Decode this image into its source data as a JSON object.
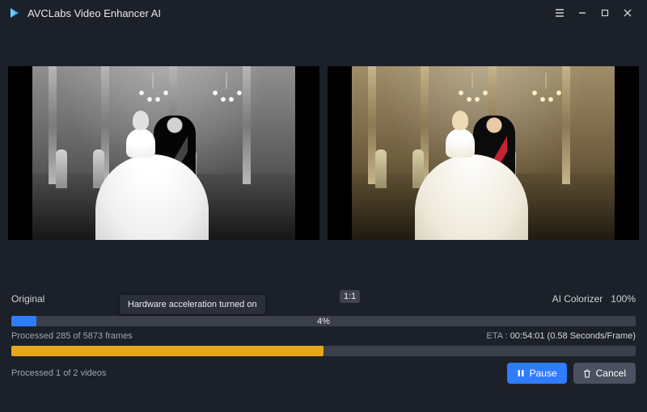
{
  "titlebar": {
    "app_name": "AVCLabs Video Enhancer AI"
  },
  "preview": {
    "left_label": "Original",
    "right_label": "AI Colorizer",
    "zoom_percent": "100%",
    "ratio_badge": "1:1"
  },
  "tooltip": {
    "hw_accel": "Hardware acceleration turned on"
  },
  "progress": {
    "percent_label": "4%",
    "percent_value": 4,
    "frames_text": "Processed 285 of 5873 frames",
    "frame_fill_percent": 50,
    "eta_prefix": "ETA :",
    "eta_value": "00:54:01 (0.58 Seconds/Frame)",
    "videos_text": "Processed 1 of 2 videos"
  },
  "buttons": {
    "pause": "Pause",
    "cancel": "Cancel"
  },
  "colors": {
    "accent_blue": "#2f7cff",
    "accent_orange": "#e6a71d",
    "bg": "#1b2029",
    "track": "#3a3f4a"
  }
}
